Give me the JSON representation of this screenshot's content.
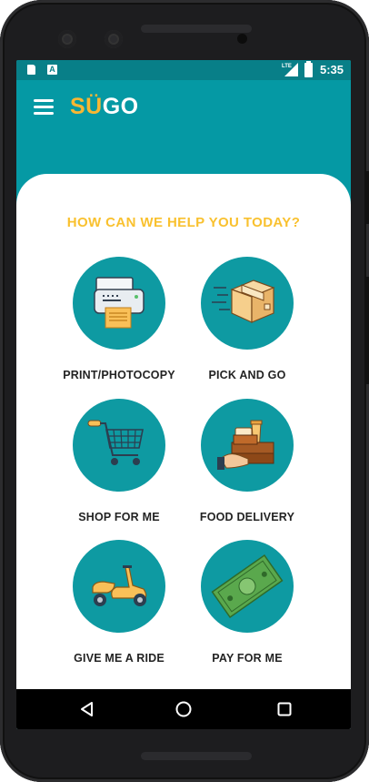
{
  "status_bar": {
    "time": "5:35",
    "icons": [
      "sim-icon",
      "a-icon",
      "lte-signal-icon",
      "battery-charging-icon"
    ]
  },
  "app_bar": {
    "menu_icon": "hamburger-menu-icon",
    "logo_part1": "SÜ",
    "logo_part2": "GO"
  },
  "main": {
    "headline": "HOW CAN WE HELP YOU TODAY?",
    "services": [
      {
        "label": "PRINT/PHOTOCOPY",
        "icon": "printer-icon"
      },
      {
        "label": "PICK AND GO",
        "icon": "package-icon"
      },
      {
        "label": "SHOP FOR ME",
        "icon": "shopping-cart-icon"
      },
      {
        "label": "FOOD DELIVERY",
        "icon": "food-delivery-icon"
      },
      {
        "label": "GIVE ME A RIDE",
        "icon": "scooter-icon"
      },
      {
        "label": "PAY FOR ME",
        "icon": "money-icon"
      }
    ]
  },
  "nav_bar": {
    "icons": [
      "back-icon",
      "home-icon",
      "recent-apps-icon"
    ]
  },
  "colors": {
    "primary": "#0599a4",
    "accent": "#f9c12f",
    "circle": "#0e9aa2"
  }
}
